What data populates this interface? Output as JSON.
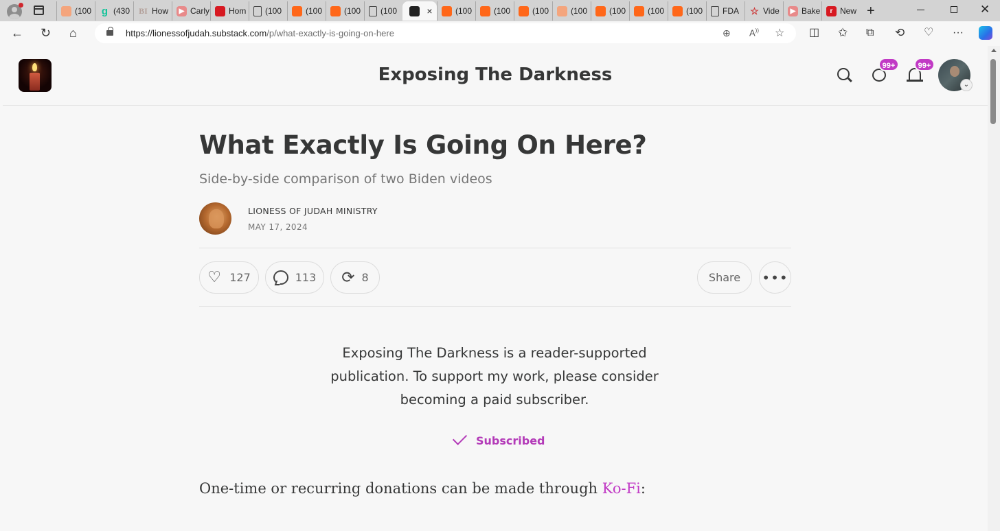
{
  "browser": {
    "tabs": [
      {
        "label": "(100",
        "favicon": "substack-faded-icon"
      },
      {
        "label": "(430",
        "favicon": "grammarly-icon"
      },
      {
        "label": "How",
        "favicon": "bi-icon"
      },
      {
        "label": "Carly",
        "favicon": "youtube-icon"
      },
      {
        "label": "Hom",
        "favicon": "red-badge-icon"
      },
      {
        "label": "(100",
        "favicon": "document-icon"
      },
      {
        "label": "(100",
        "favicon": "substack-icon"
      },
      {
        "label": "(100",
        "favicon": "substack-icon"
      },
      {
        "label": "(100",
        "favicon": "document-icon"
      }
    ],
    "active_tab": {
      "favicon": "candle-icon",
      "close": "×"
    },
    "tabs_after": [
      {
        "label": "(100",
        "favicon": "substack-icon"
      },
      {
        "label": "(100",
        "favicon": "substack-icon"
      },
      {
        "label": "(100",
        "favicon": "substack-icon"
      },
      {
        "label": "(100",
        "favicon": "substack-faded-icon"
      },
      {
        "label": "(100",
        "favicon": "substack-icon"
      },
      {
        "label": "(100",
        "favicon": "substack-icon"
      },
      {
        "label": "(100",
        "favicon": "substack-icon"
      },
      {
        "label": "FDA",
        "favicon": "document-icon"
      },
      {
        "label": "Vide",
        "favicon": "star-icon"
      },
      {
        "label": "Bake",
        "favicon": "youtube-icon"
      },
      {
        "label": "New",
        "favicon": "red-r-icon"
      }
    ],
    "new_tab": "+",
    "url_host": "https://lionessofjudah.substack.com",
    "url_path": "/p/what-exactly-is-going-on-here"
  },
  "header": {
    "site_title": "Exposing The Darkness",
    "chat_badge": "99+",
    "notif_badge": "99+"
  },
  "post": {
    "title": "What Exactly Is Going On Here?",
    "subtitle": "Side-by-side comparison of two Biden videos",
    "author": "LIONESS OF JUDAH MINISTRY",
    "date": "MAY 17, 2024",
    "likes": "127",
    "comments": "113",
    "restacks": "8",
    "share_label": "Share",
    "support_text": "Exposing The Darkness is a reader-supported publication. To support my work, please consider becoming a paid subscriber.",
    "subscribed_label": "Subscribed",
    "donation_prefix": "One-time or recurring donations can be made through ",
    "donation_link": "Ko-Fi",
    "donation_suffix": ":"
  },
  "colors": {
    "accent": "#c13ac5",
    "text": "#363737",
    "background": "#f7f7f7"
  }
}
